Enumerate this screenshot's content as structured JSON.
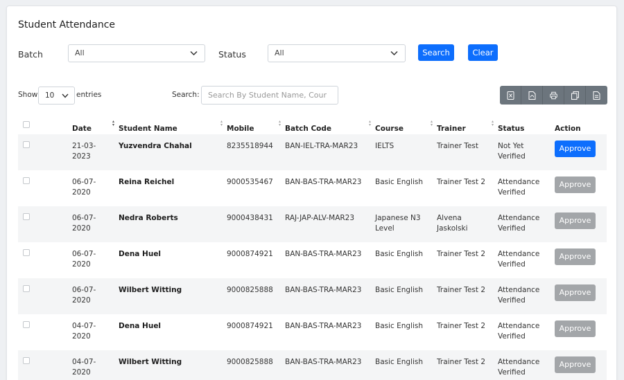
{
  "page": {
    "title": "Student Attendance"
  },
  "filters": {
    "batch_label": "Batch",
    "batch_value": "All",
    "status_label": "Status",
    "status_value": "All",
    "search_button": "Search",
    "clear_button": "Clear"
  },
  "table_controls": {
    "show_label": "Show",
    "page_length": "10",
    "entries_label": "entries",
    "search_label": "Search:",
    "search_placeholder": "Search By Student Name, Cour",
    "export_icons": [
      "excel-icon",
      "pdf-icon",
      "print-icon",
      "copy-icon",
      "csv-icon"
    ]
  },
  "columns": [
    "Date",
    "Student Name",
    "Mobile",
    "Batch Code",
    "Course",
    "Trainer",
    "Status",
    "Action"
  ],
  "rows": [
    {
      "date_1": "21-03-",
      "date_2": "2023",
      "name": "Yuzvendra Chahal",
      "mobile": "8235518944",
      "batch_code": "BAN-IEL-TRA-MAR23",
      "course_1": "IELTS",
      "course_2": "",
      "trainer_1": "Trainer Test",
      "trainer_2": "",
      "status_1": "Not Yet",
      "status_2": "Verified",
      "action": "Approve",
      "action_enabled": true
    },
    {
      "date_1": "06-07-",
      "date_2": "2020",
      "name": "Reina Reichel",
      "mobile": "9000535467",
      "batch_code": "BAN-BAS-TRA-MAR23",
      "course_1": "Basic English",
      "course_2": "",
      "trainer_1": "Trainer Test 2",
      "trainer_2": "",
      "status_1": "Attendance",
      "status_2": "Verified",
      "action": "Approve",
      "action_enabled": false
    },
    {
      "date_1": "06-07-",
      "date_2": "2020",
      "name": "Nedra Roberts",
      "mobile": "9000438431",
      "batch_code": "RAJ-JAP-ALV-MAR23",
      "course_1": "Japanese N3",
      "course_2": "Level",
      "trainer_1": "Alvena",
      "trainer_2": "Jaskolski",
      "status_1": "Attendance",
      "status_2": "Verified",
      "action": "Approve",
      "action_enabled": false
    },
    {
      "date_1": "06-07-",
      "date_2": "2020",
      "name": "Dena Huel",
      "mobile": "9000874921",
      "batch_code": "BAN-BAS-TRA-MAR23",
      "course_1": "Basic English",
      "course_2": "",
      "trainer_1": "Trainer Test 2",
      "trainer_2": "",
      "status_1": "Attendance",
      "status_2": "Verified",
      "action": "Approve",
      "action_enabled": false
    },
    {
      "date_1": "06-07-",
      "date_2": "2020",
      "name": "Wilbert Witting",
      "mobile": "9000825888",
      "batch_code": "BAN-BAS-TRA-MAR23",
      "course_1": "Basic English",
      "course_2": "",
      "trainer_1": "Trainer Test 2",
      "trainer_2": "",
      "status_1": "Attendance",
      "status_2": "Verified",
      "action": "Approve",
      "action_enabled": false
    },
    {
      "date_1": "04-07-",
      "date_2": "2020",
      "name": "Dena Huel",
      "mobile": "9000874921",
      "batch_code": "BAN-BAS-TRA-MAR23",
      "course_1": "Basic English",
      "course_2": "",
      "trainer_1": "Trainer Test 2",
      "trainer_2": "",
      "status_1": "Attendance",
      "status_2": "Verified",
      "action": "Approve",
      "action_enabled": false
    },
    {
      "date_1": "04-07-",
      "date_2": "2020",
      "name": "Wilbert Witting",
      "mobile": "9000825888",
      "batch_code": "BAN-BAS-TRA-MAR23",
      "course_1": "Basic English",
      "course_2": "",
      "trainer_1": "Trainer Test 2",
      "trainer_2": "",
      "status_1": "Attendance",
      "status_2": "Verified",
      "action": "Approve",
      "action_enabled": false
    }
  ],
  "colors": {
    "primary": "#0d6efd",
    "disabled": "#a3a6a9",
    "export": "#6c757d",
    "stripe": "#f4f5f6"
  }
}
